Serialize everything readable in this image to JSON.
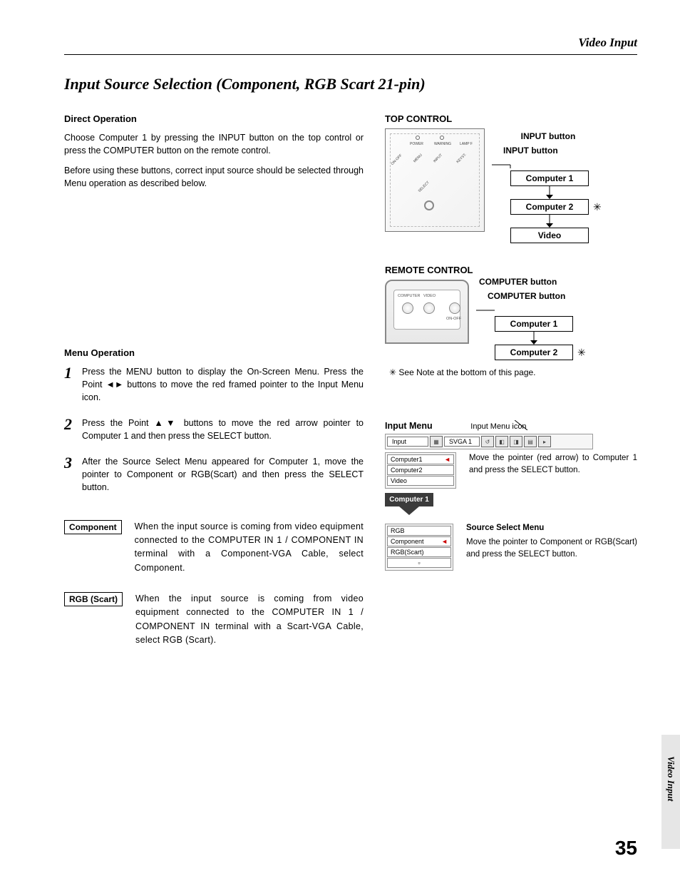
{
  "header": "Video Input",
  "title": "Input Source Selection (Component, RGB Scart 21-pin)",
  "direct_operation": {
    "heading": "Direct Operation",
    "p1": "Choose Computer 1 by pressing the INPUT button on the top control or press the COMPUTER button on the remote control.",
    "p2": "Before using these buttons, correct input source should be selected through Menu operation as described below."
  },
  "menu_operation": {
    "heading": "Menu Operation",
    "steps": [
      "Press the MENU button to display the On-Screen Menu.  Press the Point ◄► buttons to move the red framed pointer to the Input Menu icon.",
      "Press the Point ▲▼ buttons to move the red arrow pointer to Computer 1 and then press the SELECT button.",
      "After the Source Select Menu appeared for Computer 1, move the pointer to Component or RGB(Scart) and then press the SELECT button."
    ],
    "step_nums": [
      "1",
      "2",
      "3"
    ]
  },
  "options": {
    "component": {
      "label": "Component",
      "text": "When the input source is coming from video equipment connected to the COMPUTER IN 1 / COMPONENT IN terminal with a Component-VGA Cable, select Component."
    },
    "rgb_scart": {
      "label": "RGB (Scart)",
      "text": "When the input source is coming from video equipment connected to the COMPUTER IN 1 / COMPONENT IN terminal with a Scart-VGA Cable, select RGB (Scart)."
    }
  },
  "top_control": {
    "heading": "TOP CONTROL",
    "input_button_top": "INPUT button",
    "input_button_sub": "INPUT button",
    "items": [
      "Computer 1",
      "Computer 2",
      "Video"
    ],
    "panel_labels": {
      "power": "POWER",
      "warning": "WARNING",
      "lamp": "LAMP F",
      "onoff": "ON-OFF",
      "menu": "MENU",
      "input": "INPUT",
      "keyst": "KEYST.",
      "select": "SELECT"
    }
  },
  "remote_control": {
    "heading": "REMOTE CONTROL",
    "computer_button_top": "COMPUTER button",
    "computer_button_sub": "COMPUTER button",
    "items": [
      "Computer 1",
      "Computer 2"
    ],
    "labels": {
      "computer": "COMPUTER",
      "video": "VIDEO",
      "onoff": "ON-OFF"
    }
  },
  "note": "✳ See Note at the bottom of this page.",
  "input_menu": {
    "heading": "Input Menu",
    "icon_note": "Input Menu icon",
    "topbar": {
      "label": "Input",
      "mode": "SVGA 1"
    },
    "list": [
      "Computer1",
      "Computer2",
      "Video"
    ],
    "text1": "Move the pointer (red arrow) to Computer 1 and press the SELECT button.",
    "dark": "Computer 1",
    "src_heading": "Source Select Menu",
    "src_list": [
      "RGB",
      "Component",
      "RGB(Scart)"
    ],
    "text2": "Move the pointer to Component or RGB(Scart) and press the SELECT button."
  },
  "side_tab": "Video Input",
  "page_number": "35",
  "star": "✳"
}
